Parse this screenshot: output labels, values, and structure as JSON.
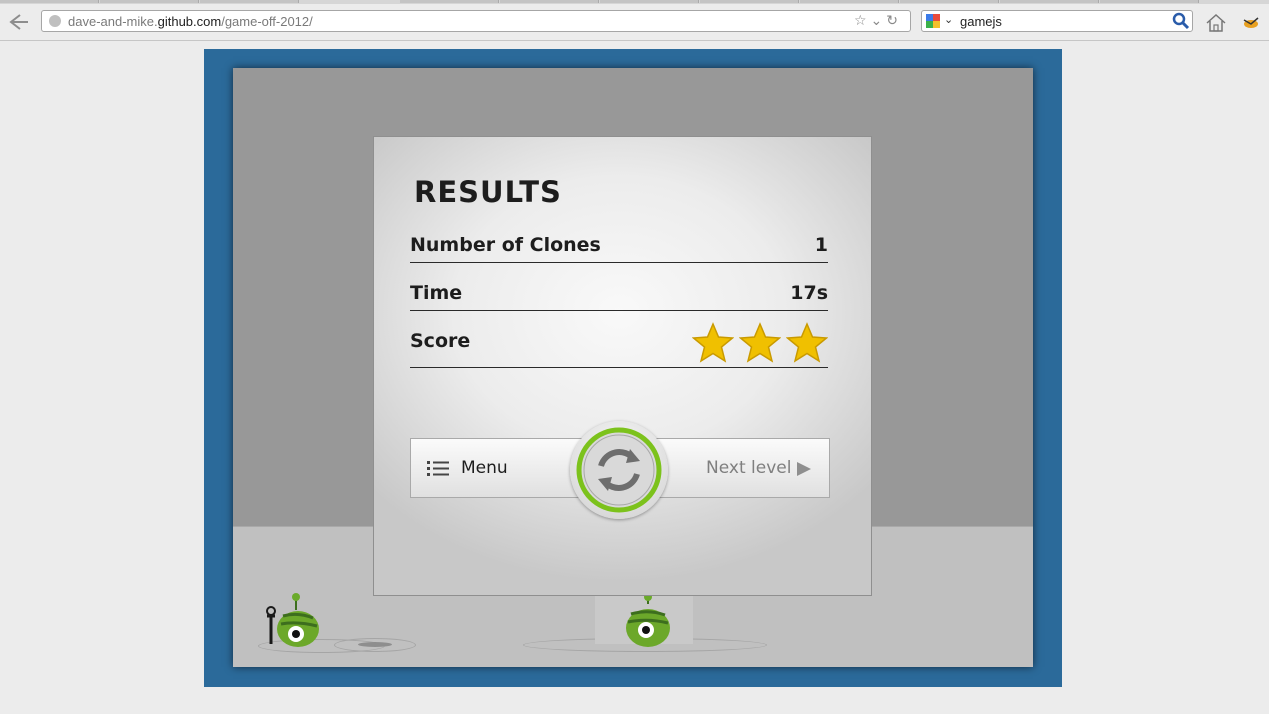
{
  "browser": {
    "url_domain_prefix": "dave-and-mike.",
    "url_domain": "github.com",
    "url_path": "/game-off-2012/",
    "search_query": "gamejs",
    "icons": [
      "back-arrow-icon",
      "site-identity-icon",
      "bookmark-star-icon",
      "dropdown-icon",
      "reload-icon",
      "search-engine-icon",
      "magnifier-icon",
      "home-icon",
      "addon-icon"
    ]
  },
  "results": {
    "title": "RESULTS",
    "rows": [
      {
        "label": "Number of Clones",
        "value": "1"
      },
      {
        "label": "Time",
        "value": "17s"
      },
      {
        "label": "Score",
        "stars_earned": 3,
        "stars_total": 3
      }
    ],
    "buttons": {
      "menu": "Menu",
      "restart_icon": "restart-icon",
      "next": "Next level"
    }
  },
  "colors": {
    "game_frame": "#2b6a9a",
    "star": "#f0c000",
    "restart_ring": "#7cc21c"
  }
}
